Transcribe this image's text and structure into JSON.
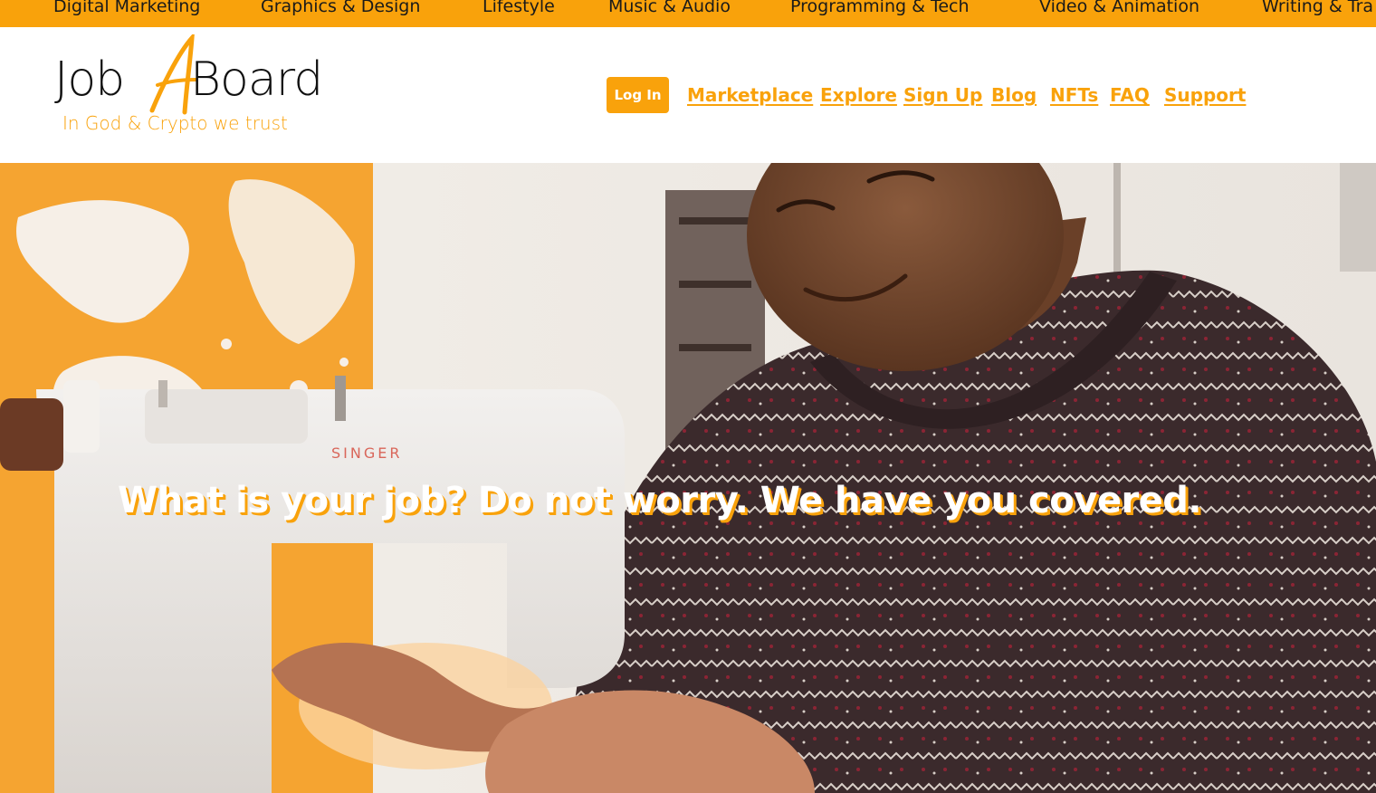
{
  "categories": [
    "Digital Marketing",
    "Graphics & Design",
    "Lifestyle",
    "Music & Audio",
    "Programming & Tech",
    "Video & Animation",
    "Writing & Tra"
  ],
  "logo": {
    "word_left": "Job",
    "word_middle": "A",
    "word_right": "Board",
    "tagline": "In God & Crypto we trust"
  },
  "nav": {
    "login_label": "Log In",
    "links": [
      "Marketplace",
      "Explore",
      "Sign Up",
      "Blog",
      "NFTs",
      "FAQ",
      "Support"
    ]
  },
  "hero": {
    "headline": "What is your job? Do not worry. We have you covered.",
    "image_text": "SINGER"
  },
  "colors": {
    "accent": "#f9a20b",
    "text_dark": "#111111",
    "white": "#ffffff"
  }
}
